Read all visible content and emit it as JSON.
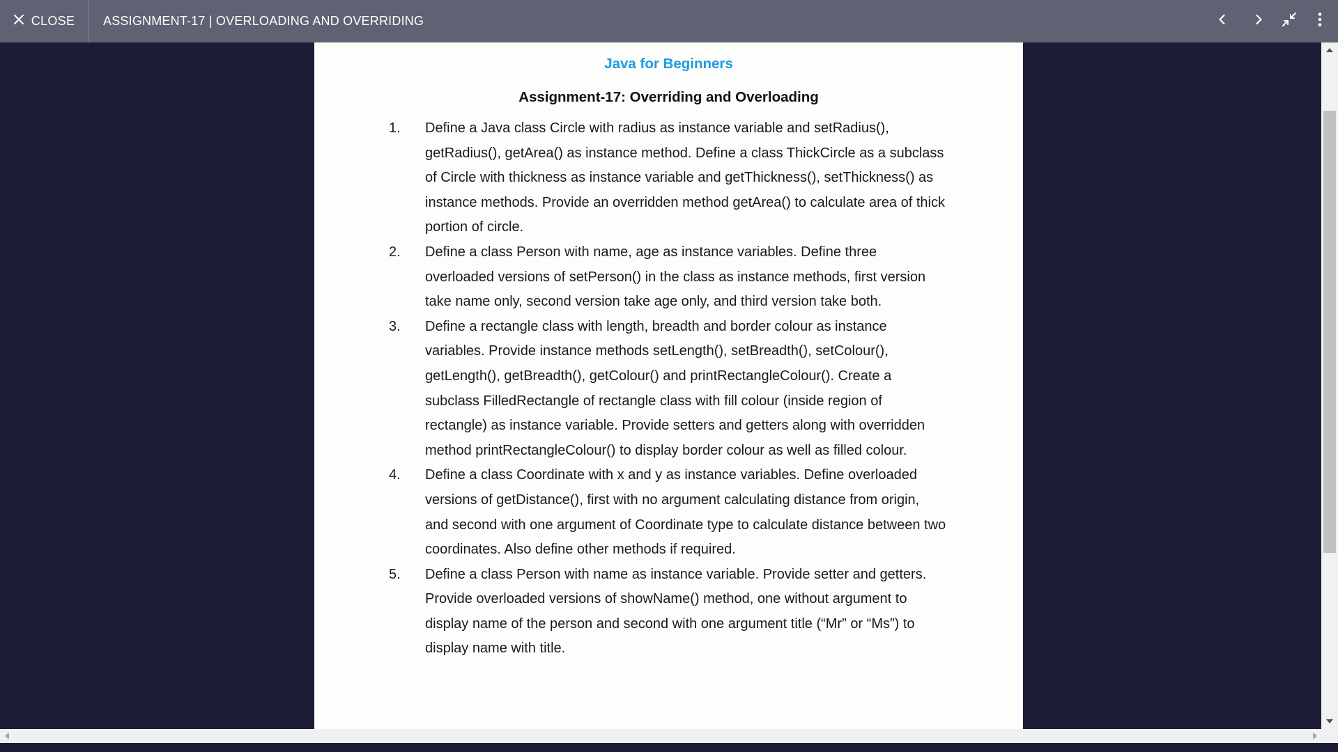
{
  "toolbar": {
    "close_label": "CLOSE",
    "title": "ASSIGNMENT-17 | OVERLOADING AND OVERRIDING"
  },
  "document": {
    "heading": "Java for Beginners",
    "subheading": "Assignment-17: Overriding and Overloading",
    "questions": [
      {
        "number": "1.",
        "text": "Define a Java class Circle with radius as instance variable and setRadius(), getRadius(), getArea() as instance method. Define a class ThickCircle as a subclass of Circle with thickness as instance variable and getThickness(), setThickness() as instance methods. Provide an overridden method getArea() to calculate area of thick portion of circle."
      },
      {
        "number": "2.",
        "text": "Define a class Person with name, age as instance variables. Define three overloaded versions of setPerson() in the class as instance methods, first version take name only, second version take age only, and third version take both."
      },
      {
        "number": "3.",
        "text": "Define a rectangle class with length, breadth and border colour as instance variables. Provide instance methods setLength(), setBreadth(), setColour(), getLength(), getBreadth(), getColour() and printRectangleColour(). Create a subclass FilledRectangle of rectangle class with fill colour (inside region of rectangle) as instance variable. Provide setters and getters along with overridden method printRectangleColour() to display border colour as well as filled colour."
      },
      {
        "number": "4.",
        "text": "Define a class Coordinate with x and y as instance variables. Define overloaded versions of getDistance(), first with no argument calculating distance from origin, and second with one argument of Coordinate type to calculate distance between two coordinates. Also define other methods if required."
      },
      {
        "number": "5.",
        "text": "Define a class Person with name as instance variable. Provide setter and getters. Provide overloaded versions of showName() method, one without argument to display name of the person and second with one argument title (“Mr” or “Ms”) to display name with title."
      }
    ]
  },
  "colors": {
    "toolbar_bg": "#5e6272",
    "viewer_bg": "#1a1d35",
    "heading_blue": "#1c9ae3",
    "page_bg": "#fdfdfb"
  },
  "icons": {
    "close": "close-icon",
    "prev": "chevron-left-icon",
    "next": "chevron-right-icon",
    "exit_fullscreen": "exit-fullscreen-icon",
    "more": "more-vertical-icon"
  }
}
